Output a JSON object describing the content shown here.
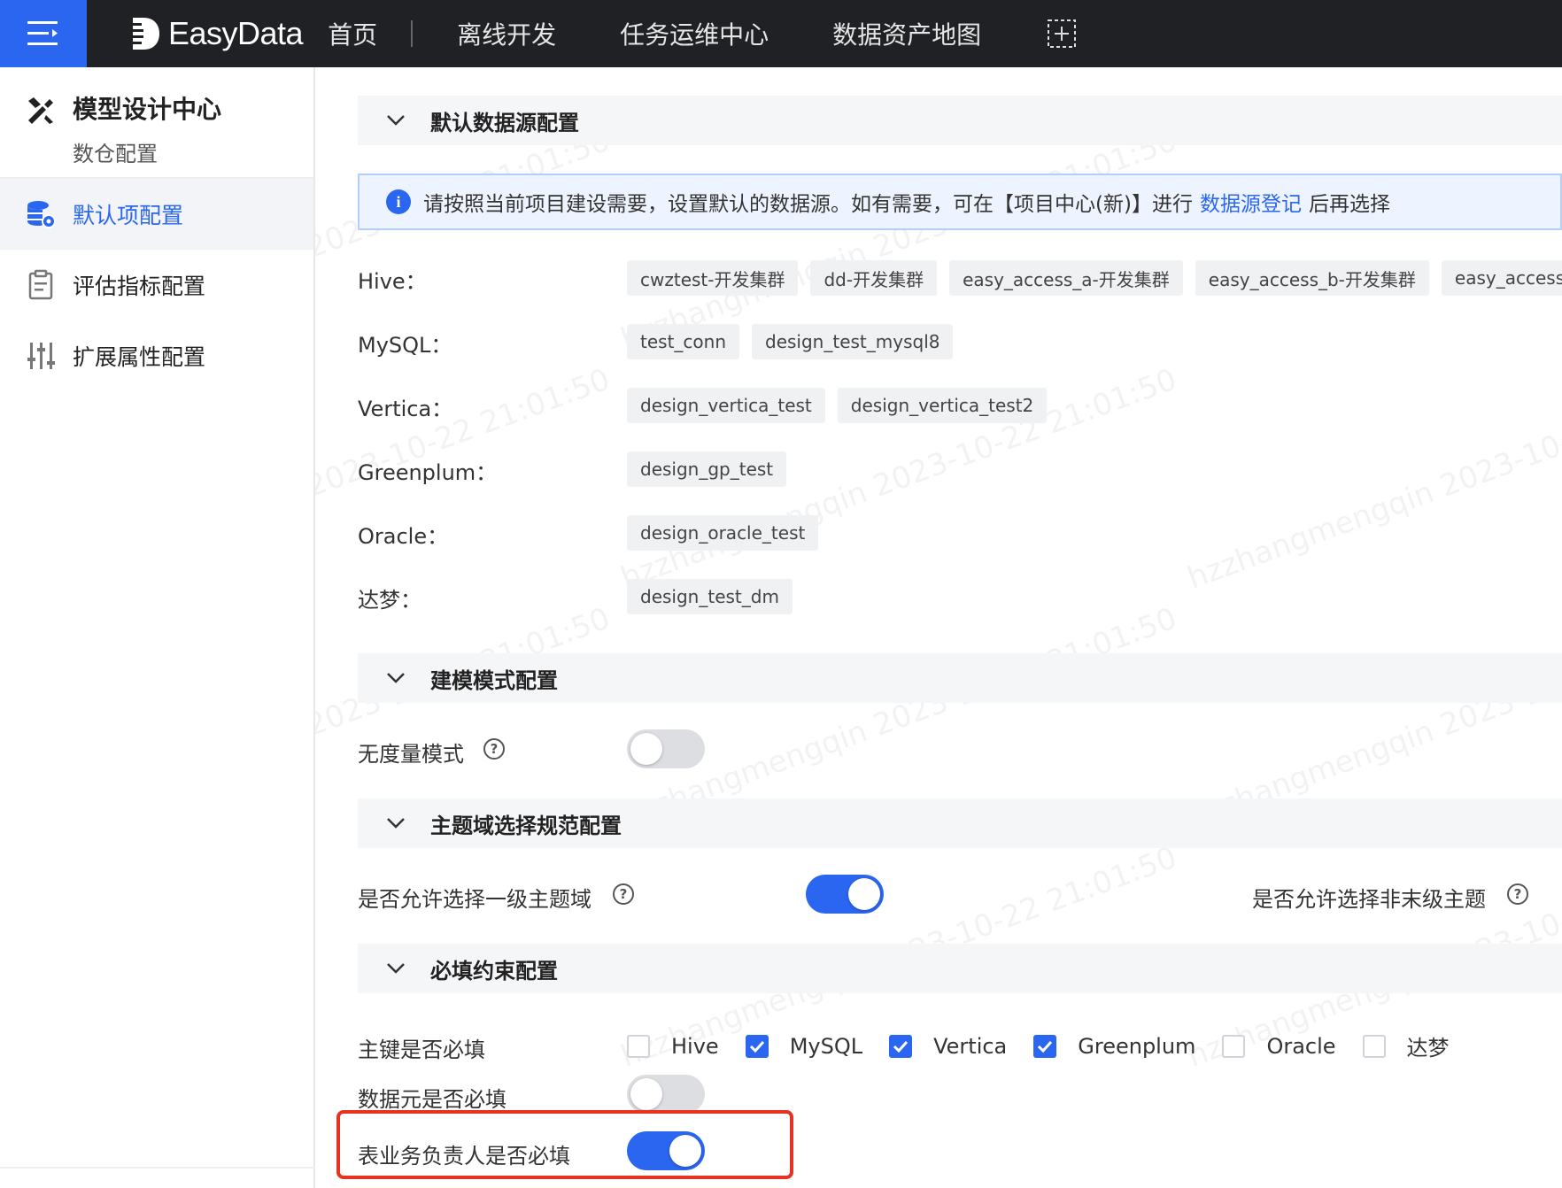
{
  "topbar": {
    "brand": "EasyData",
    "nav": [
      "首页",
      "离线开发",
      "任务运维中心",
      "数据资产地图"
    ]
  },
  "sidebar": {
    "title": "模型设计中心",
    "subtitle": "数仓配置",
    "items": [
      {
        "label": "默认项配置",
        "icon": "database-settings-icon",
        "active": true
      },
      {
        "label": "评估指标配置",
        "icon": "clipboard-icon",
        "active": false
      },
      {
        "label": "扩展属性配置",
        "icon": "sliders-icon",
        "active": false
      }
    ]
  },
  "sections": {
    "datasource": "默认数据源配置",
    "modeling": "建模模式配置",
    "subject": "主题域选择规范配置",
    "required": "必填约束配置"
  },
  "info": {
    "text_before": "请按照当前项目建设需要，设置默认的数据源。如有需要，可在【项目中心(新)】进行",
    "link": "数据源登记",
    "text_after": "后再选择"
  },
  "datasources": [
    {
      "label": "Hive：",
      "tags": [
        "cwztest-开发集群",
        "dd-开发集群",
        "easy_access_a-开发集群",
        "easy_access_b-开发集群",
        "easy_access"
      ]
    },
    {
      "label": "MySQL：",
      "tags": [
        "test_conn",
        "design_test_mysql8"
      ]
    },
    {
      "label": "Vertica：",
      "tags": [
        "design_vertica_test",
        "design_vertica_test2"
      ]
    },
    {
      "label": "Greenplum：",
      "tags": [
        "design_gp_test"
      ]
    },
    {
      "label": "Oracle：",
      "tags": [
        "design_oracle_test"
      ]
    },
    {
      "label": "达梦：",
      "tags": [
        "design_test_dm"
      ]
    }
  ],
  "modeling": {
    "no_measure_label": "无度量模式",
    "no_measure_on": false
  },
  "subject": {
    "allow_level1_label": "是否允许选择一级主题域",
    "allow_level1_on": true,
    "allow_nonleaf_label": "是否允许选择非末级主题"
  },
  "required": {
    "pk_label": "主键是否必填",
    "pk_options": [
      {
        "label": "Hive",
        "checked": false
      },
      {
        "label": "MySQL",
        "checked": true
      },
      {
        "label": "Vertica",
        "checked": true
      },
      {
        "label": "Greenplum",
        "checked": true
      },
      {
        "label": "Oracle",
        "checked": false
      },
      {
        "label": "达梦",
        "checked": false
      }
    ],
    "data_element_label": "数据元是否必填",
    "data_element_on": false,
    "owner_label": "表业务负责人是否必填",
    "owner_on": true
  },
  "watermark": "hzzhangmengqin 2023-10-22 21:01:50",
  "colors": {
    "accent": "#2a66f0",
    "topbar": "#1f2125",
    "highlight": "#e6321e"
  }
}
